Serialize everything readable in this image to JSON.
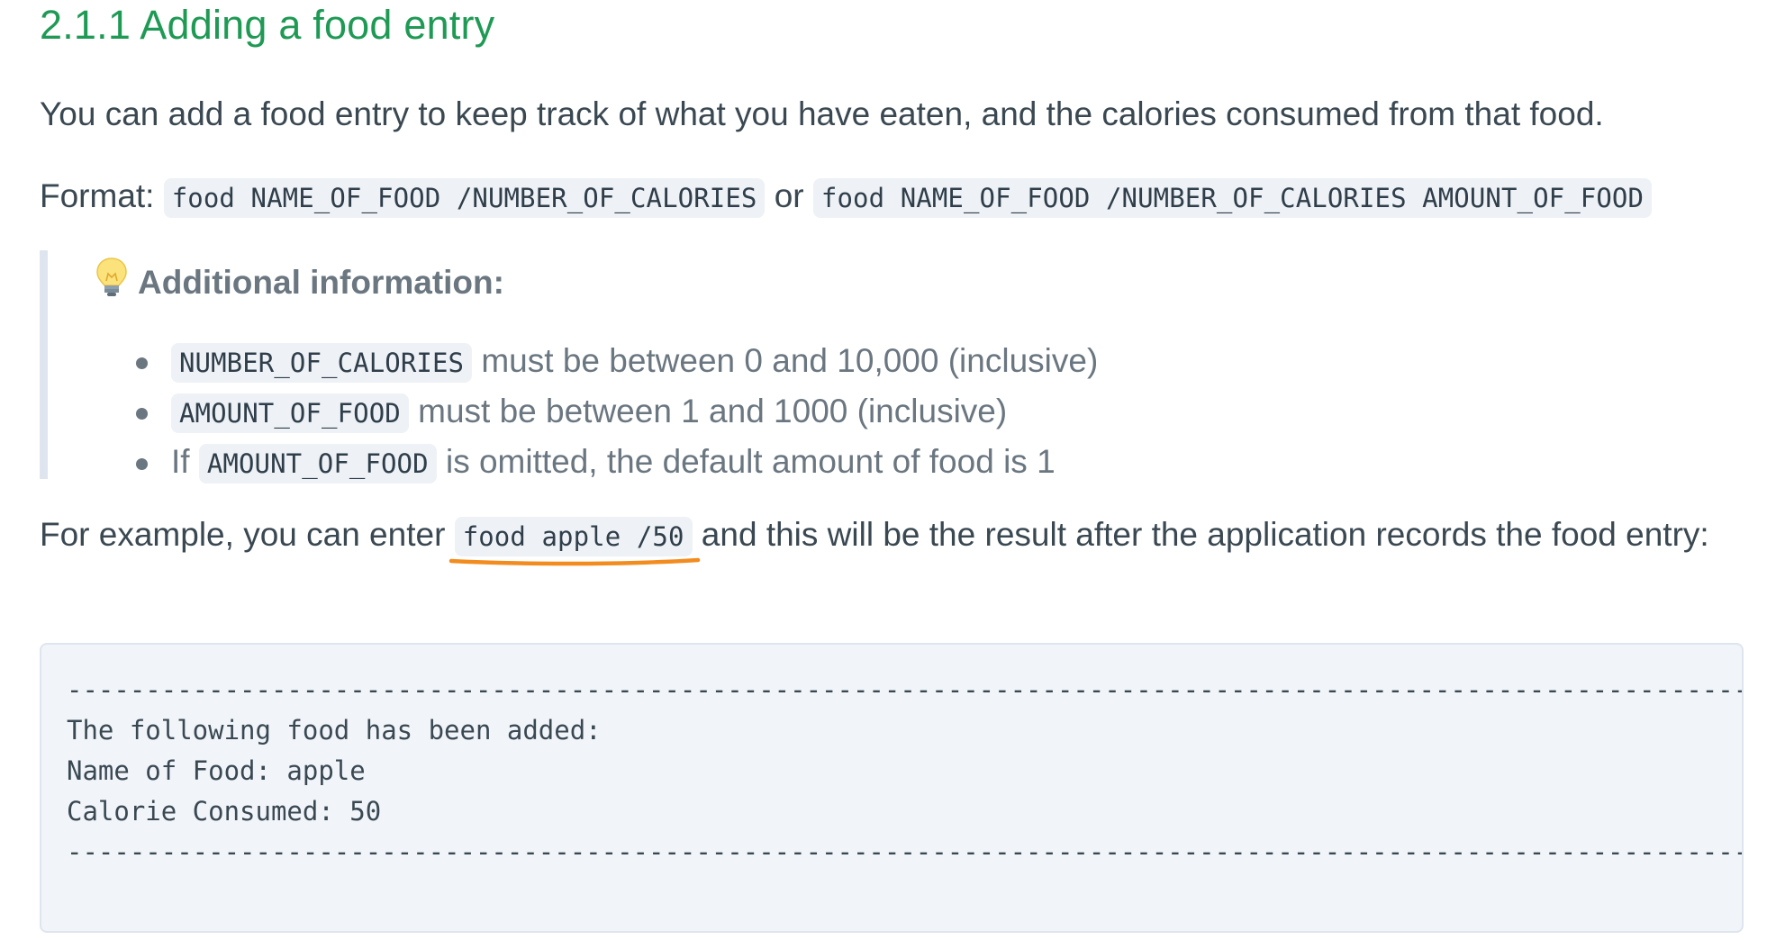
{
  "section": {
    "title": "2.1.1 Adding a food entry"
  },
  "intro": {
    "text": "You can add a food entry to keep track of what you have eaten, and the calories consumed from that food."
  },
  "format": {
    "label": "Format:",
    "code1": "food NAME_OF_FOOD /NUMBER_OF_CALORIES",
    "or": "or",
    "code2": "food NAME_OF_FOOD /NUMBER_OF_CALORIES AMOUNT_OF_FOOD"
  },
  "callout": {
    "icon": "lightbulb-icon",
    "title": "Additional information:",
    "items": [
      {
        "code": "NUMBER_OF_CALORIES",
        "text": " must be between 0 and 10,000 (inclusive)"
      },
      {
        "code": "AMOUNT_OF_FOOD",
        "text": " must be between 1 and 1000 (inclusive)"
      },
      {
        "prefix": "If ",
        "code": "AMOUNT_OF_FOOD",
        "text": " is omitted, the default amount of food is 1"
      }
    ]
  },
  "example": {
    "before": "For example, you can enter ",
    "code": "food apple /50",
    "after": " and this will be the result after the application records the food entry:"
  },
  "output": {
    "separator": "----------------------------------------------------------------------------------------------------------------------------",
    "lines": [
      "The following food has been added:",
      "Name of Food: apple",
      "Calorie Consumed: 50"
    ]
  },
  "colors": {
    "heading": "#1f9a55",
    "underline": "#f28c1e",
    "callout_border": "#dfe5ee",
    "code_bg": "#eef2f6"
  }
}
